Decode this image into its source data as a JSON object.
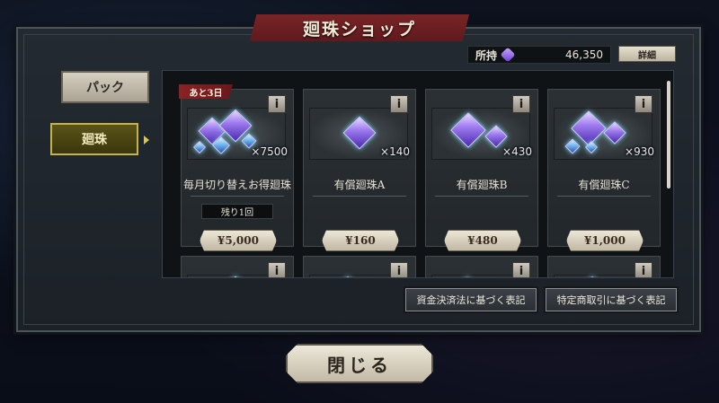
{
  "header": {
    "title": "廻珠ショップ"
  },
  "currency": {
    "label": "所持",
    "icon": "gem-icon",
    "amount": "46,350",
    "detail_label": "詳細"
  },
  "tabs": [
    {
      "label": "パック",
      "selected": false
    },
    {
      "label": "廻珠",
      "selected": true
    }
  ],
  "products": [
    {
      "name": "毎月切り替えお得廻珠",
      "quantity": "×7500",
      "price": "¥5,000",
      "badge": "あと3日",
      "limit": "残り1回",
      "info_label": "i"
    },
    {
      "name": "有償廻珠A",
      "quantity": "×140",
      "price": "¥160",
      "info_label": "i"
    },
    {
      "name": "有償廻珠B",
      "quantity": "×430",
      "price": "¥480",
      "info_label": "i"
    },
    {
      "name": "有償廻珠C",
      "quantity": "×930",
      "price": "¥1,000",
      "info_label": "i"
    }
  ],
  "second_row_info_label": "i",
  "legal": {
    "payment_services_label": "資金決済法に基づく表記",
    "commercial_transactions_label": "特定商取引に基づく表記"
  },
  "close_label": "閉じる",
  "colors": {
    "accent_red": "#7a2426",
    "selected_tab": "#c8b24a",
    "gem_purple": "#a07cf0"
  }
}
